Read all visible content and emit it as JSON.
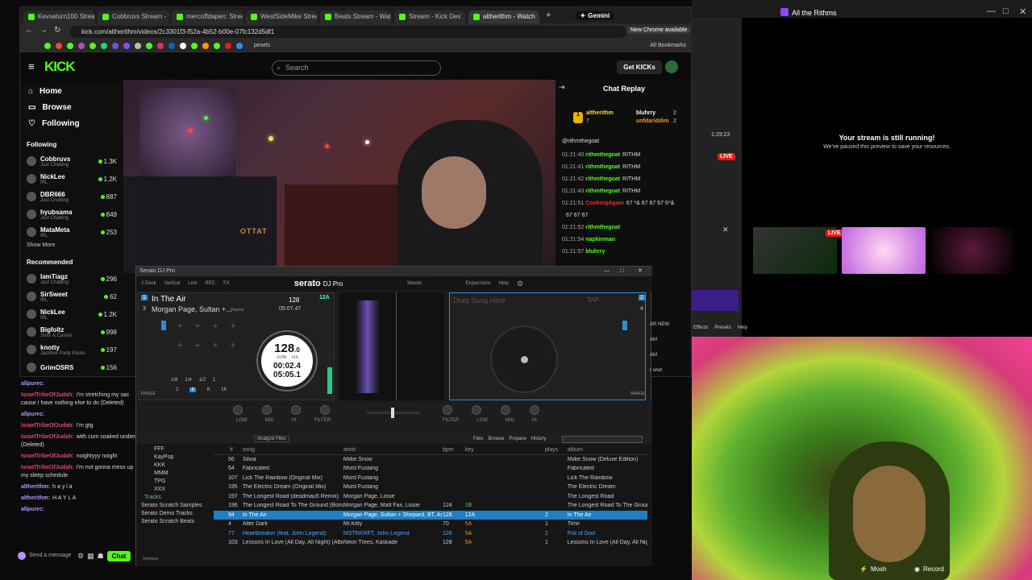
{
  "browser": {
    "tabs": [
      "Kevsaturn100 Stream",
      "Cobbruvs Stream - W",
      "mercoffdapen: Stream",
      "WestSideMike Stream",
      "Beats Stream - Watch",
      "Stream - Kick Dex",
      "altherithm - Watch"
    ],
    "new_tab": "+",
    "gemini": "Gemini",
    "url": "kick.com/altherithm/videos/2c3301f3-f52a-4b52-b00e-07fc132d5df1",
    "chrome_badge": "New Chrome available",
    "bookmarks_label": "All Bookmarks",
    "pexels": "pexels"
  },
  "kick": {
    "logo": "KICK",
    "search_placeholder": "Search",
    "get_kicks": "Get KICKs",
    "nav": [
      {
        "label": "Home",
        "icon": "home-icon"
      },
      {
        "label": "Browse",
        "icon": "browse-icon"
      },
      {
        "label": "Following",
        "icon": "heart-icon"
      }
    ],
    "following_title": "Following",
    "following": [
      {
        "name": "Cobbruvs",
        "cat": "Just Chatting",
        "viewers": "1.3K"
      },
      {
        "name": "NickLee",
        "cat": "IRL",
        "viewers": "1.2K"
      },
      {
        "name": "DBR666",
        "cat": "Just Chatting",
        "viewers": "887"
      },
      {
        "name": "hyubsama",
        "cat": "Just Chatting",
        "viewers": "849"
      },
      {
        "name": "MataMeta",
        "cat": "IRL",
        "viewers": "253"
      }
    ],
    "show_more": "Show More",
    "recommended_title": "Recommended",
    "recommended": [
      {
        "name": "IamTiagz",
        "cat": "Just Chatting",
        "viewers": "296"
      },
      {
        "name": "SirSweet",
        "cat": "IRL",
        "viewers": "62"
      },
      {
        "name": "NickLee",
        "cat": "IRL",
        "viewers": "1.2K"
      },
      {
        "name": "Bigfoltz",
        "cat": "Slots & Casino",
        "viewers": "998"
      },
      {
        "name": "knotty",
        "cat": "Jackbox Party Packs",
        "viewers": "197"
      },
      {
        "name": "GrimOSRS",
        "cat": "",
        "viewers": "156"
      }
    ],
    "video_sign": "OTTAT"
  },
  "chat_replay": {
    "title": "Chat Replay",
    "gifters": [
      {
        "rank": "1",
        "name": "altherithm",
        "count": "7"
      },
      {
        "name": "bluhrry",
        "count": "2"
      },
      {
        "name": "unfdariddim",
        "count": "2"
      }
    ],
    "pinned": "@rithmthegoat",
    "messages": [
      {
        "time": "01:21:40",
        "user": "rithmthegoat",
        "text": "RITHM",
        "color": "#53fc18"
      },
      {
        "time": "01:21:41",
        "user": "rithmthegoat",
        "text": "RITHM",
        "color": "#53fc18"
      },
      {
        "time": "01:21:42",
        "user": "rithmthegoat",
        "text": "RITHM",
        "color": "#53fc18"
      },
      {
        "time": "01:21:43",
        "user": "rithmthegoat",
        "text": "RITHM",
        "color": "#53fc18"
      },
      {
        "time": "01:21:51",
        "user": "CookingAgain",
        "text": "67 *& 67 67 67 6*&",
        "color": "#e03030"
      },
      {
        "time": "",
        "user": "",
        "text": "67 67 67",
        "color": "#53fc18"
      },
      {
        "time": "01:21:52",
        "user": "rithmthegoat",
        "text": "",
        "color": "#53fc18"
      },
      {
        "time": "01:21:54",
        "user": "napkinman",
        "text": "",
        "color": "#53fc18"
      },
      {
        "time": "01:21:57",
        "user": "bluhrry",
        "text": "",
        "color": "#53fc18"
      }
    ]
  },
  "left_chat": {
    "messages": [
      {
        "user": "allpurec:",
        "text": "",
        "color": "#b592ff"
      },
      {
        "user": "IsraelTribeOfJudah:",
        "text": "I'm stretching my sac cause I have nothing else to do (Deleted)",
        "color": "#e0457b"
      },
      {
        "user": "allpurec:",
        "text": "",
        "color": "#b592ff"
      },
      {
        "user": "IsraelTribeOfJudah:",
        "text": "I'm gtg",
        "color": "#e0457b"
      },
      {
        "user": "IsraelTribeOfJudah:",
        "text": "with cum soaked undies (Deleted)",
        "color": "#e0457b"
      },
      {
        "user": "IsraelTribeOfJudah:",
        "text": "noightyyy noight",
        "color": "#e0457b"
      },
      {
        "user": "IsraelTribeOfJudah:",
        "text": "I'm not gonna mess up my sleep schedule",
        "color": "#e0457b"
      },
      {
        "user": "altherithm:",
        "text": "h a y l a",
        "color": "#b592ff"
      },
      {
        "user": "altherithm:",
        "text": "H A Y L A",
        "color": "#b592ff"
      },
      {
        "user": "allpurec:",
        "text": "",
        "color": "#b592ff"
      }
    ],
    "send_placeholder": "Send a message",
    "chat_button": "Chat"
  },
  "serato": {
    "window_title": "Serato DJ Pro",
    "logo": "serato",
    "logo_suffix": "DJ Pro",
    "toolbar": [
      "2 Deck",
      "Vertical",
      "Link",
      "REC",
      "FX",
      "Master",
      "Expansions",
      "Help"
    ],
    "deckA": {
      "num": "1",
      "title": "In The Air",
      "artist": "Morgan Page, Sultan +...",
      "bpm_small": "128",
      "key": "12A",
      "time": "05:07.47",
      "repeat": "Repeat",
      "num2": "3",
      "bpm": "128",
      "bpm_dec": ".0",
      "pitch": "-0.0%",
      "range": "±16",
      "elapsed": "00:02.4",
      "remain": "05:05.1",
      "loop_vals": [
        "1/8",
        "1/4",
        "1/2",
        "1",
        "2",
        "4",
        "8",
        "16"
      ],
      "range_label": "RANGE"
    },
    "deckB": {
      "num": "2",
      "num2": "4",
      "placeholder": "Drag Song Here",
      "tap": "TAP",
      "range_label": "RANGE"
    },
    "mixer_labels": [
      "LOW",
      "MID",
      "HI",
      "FILTER",
      "FILTER",
      "LOW",
      "MID",
      "HI"
    ],
    "lib_tabs": [
      "Files",
      "Browse",
      "Prepare",
      "History"
    ],
    "analyze": "Analyze Files",
    "crates": [
      "FFF",
      "KayPop",
      "KKK",
      "MMM",
      "TPG",
      "XXX",
      "Tracks",
      "Serato Scratch Samples",
      "Serato Demo Tracks",
      "Serato Scratch Beats"
    ],
    "columns": [
      "#",
      "song",
      "artist",
      "bpm",
      "key",
      "plays",
      "album"
    ],
    "tracks": [
      {
        "n": "56",
        "song": "Silvia",
        "artist": "Miike Snow",
        "bpm": "",
        "key": "",
        "plays": "",
        "album": "Miike Snow (Deluxe Edition)"
      },
      {
        "n": "64",
        "song": "Fabricated",
        "artist": "Mord Fustang",
        "bpm": "",
        "key": "",
        "plays": "",
        "album": "Fabricated"
      },
      {
        "n": "107",
        "song": "Lick The Rainbow (Original Mix)",
        "artist": "Mord Fustang",
        "bpm": "",
        "key": "",
        "plays": "",
        "album": "Lick The Rainbow"
      },
      {
        "n": "195",
        "song": "The Electric Dream (Original Mix)",
        "artist": "Mord Fustang",
        "bpm": "",
        "key": "",
        "plays": "",
        "album": "The Electric Dream"
      },
      {
        "n": "197",
        "song": "The Longest Road (deadmau5 Remix)",
        "artist": "Morgan Page, Lissie",
        "bpm": "",
        "key": "",
        "plays": "",
        "album": "The Longest Road"
      },
      {
        "n": "196",
        "song": "The Longest Road To The Ground (Bonus",
        "artist": "Morgan Page, Matt Fax, Lissie",
        "bpm": "124",
        "key": "1B",
        "plays": "",
        "album": "The Longest Road To The Ground"
      },
      {
        "n": "94",
        "song": "In The Air",
        "artist": "Morgan Page, Sultan + Shepard, BT, Angie",
        "bpm": "128",
        "key": "12A",
        "plays": "2",
        "album": "In The Air"
      },
      {
        "n": "4",
        "song": "Alter Dark",
        "artist": "Mr.Kitty",
        "bpm": "70",
        "key": "5A",
        "plays": "1",
        "album": "Time"
      },
      {
        "n": "77",
        "song": "Heartbreaker (feat. John Legend)",
        "artist": "MSTRKRFT, John Legend",
        "bpm": "128",
        "key": "5A",
        "plays": "2",
        "album": "Fist of God"
      },
      {
        "n": "103",
        "song": "Lessons In Love (All Day, All Night) (Album",
        "artist": "Neon Trees, Kaskade",
        "bpm": "128",
        "key": "9A",
        "plays": "1",
        "album": "Lessons In Love (All Day, All Night)"
      }
    ],
    "autoplay": "Autoplay"
  },
  "right_app": {
    "title": "All the Rithms",
    "stream_msg": "Your stream is still running!",
    "stream_sub": "We've paused this preview to save your resources.",
    "timer": "1:29:23",
    "live": "LIVE",
    "menu": [
      "Effects",
      "Presets",
      "Help"
    ],
    "peek": [
      "AR NEW",
      "AM",
      "AM",
      "r shot"
    ],
    "mosh": "Mosh",
    "record": "Record"
  }
}
